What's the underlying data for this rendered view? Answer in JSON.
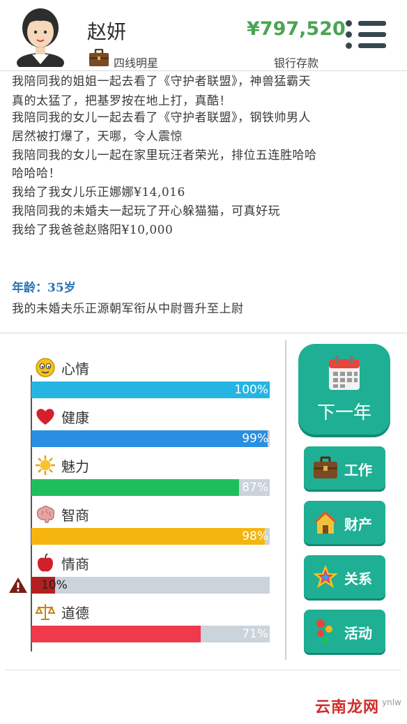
{
  "header": {
    "name": "赵妍",
    "job": "四线明星",
    "money": "¥797,520",
    "money_label": "银行存款"
  },
  "log": {
    "lines": [
      "我陪同我的姐姐一起去看了《守护者联盟》，神兽猛霸天",
      "真的太猛了，把基罗按在地上打，真酷！",
      "我陪同我的女儿一起去看了《守护者联盟》，钢铁帅男人",
      "居然被打爆了，天哪，令人震惊",
      "我陪同我的女儿一起在家里玩汪者荣光，排位五连胜哈哈",
      "哈哈哈！",
      "我给了我女儿乐正娜娜¥14,016",
      "我陪同我的未婚夫一起玩了开心躲猫猫，可真好玩",
      "我给了我爸爸赵赂阳¥10,000"
    ],
    "age_header": "年龄：35岁",
    "age_event": "我的未婚夫乐正源朝军衔从中尉晋升至上尉"
  },
  "stats": [
    {
      "label": "心情",
      "value": 100,
      "text": "100%",
      "color": "#26b5e0",
      "icon": "smiley-icon"
    },
    {
      "label": "健康",
      "value": 99,
      "text": "99%",
      "color": "#2a8fe0",
      "icon": "heart-icon"
    },
    {
      "label": "魅力",
      "value": 87,
      "text": "87%",
      "color": "#1fbe5c",
      "icon": "sun-icon"
    },
    {
      "label": "智商",
      "value": 98,
      "text": "98%",
      "color": "#f5b50e",
      "icon": "brain-icon"
    },
    {
      "label": "情商",
      "value": 10,
      "text": "10%",
      "color": "#b51f1f",
      "icon": "apple-icon"
    },
    {
      "label": "道德",
      "value": 71,
      "text": "71%",
      "color": "#ee3a4a",
      "icon": "scales-icon"
    }
  ],
  "buttons": {
    "next_year": "下一年",
    "work": "工作",
    "property": "财产",
    "relations": "关系",
    "activity": "活动"
  },
  "watermark": "云南龙网",
  "watermark_small": "ynlw"
}
